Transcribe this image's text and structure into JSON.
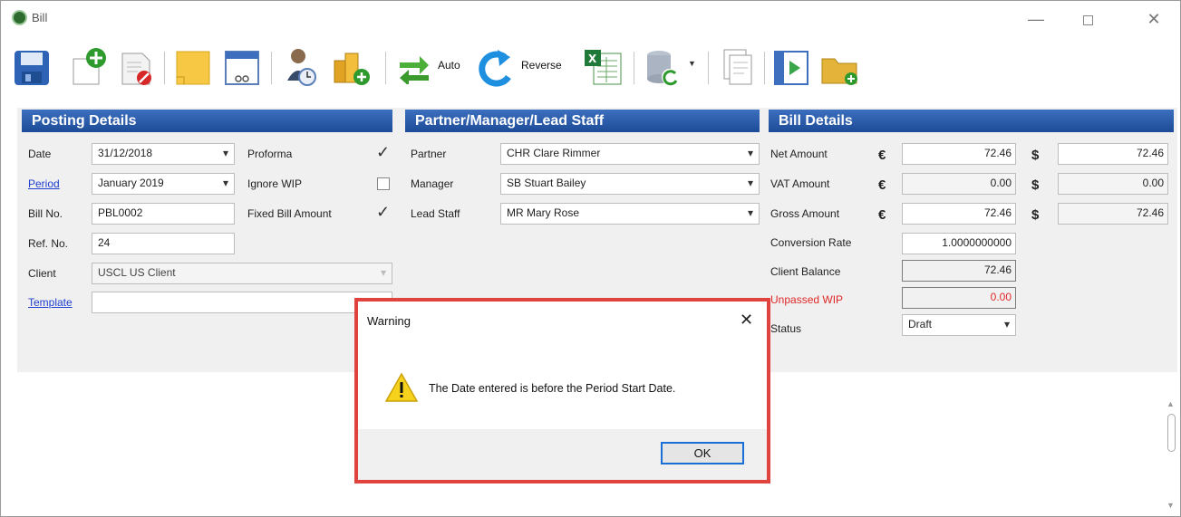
{
  "window": {
    "title": "Bill"
  },
  "toolbar": {
    "auto_label": "Auto",
    "reverse_label": "Reverse"
  },
  "posting": {
    "header": "Posting Details",
    "date_label": "Date",
    "date_value": "31/12/2018",
    "period_label": "Period",
    "period_value": "January 2019",
    "bill_no_label": "Bill No.",
    "bill_no_value": "PBL0002",
    "ref_no_label": "Ref. No.",
    "ref_no_value": "24",
    "client_label": "Client",
    "client_value": "USCL   US Client",
    "template_label": "Template",
    "template_value": "",
    "proforma_label": "Proforma",
    "proforma_checked": true,
    "ignore_wip_label": "Ignore WIP",
    "ignore_wip_checked": false,
    "fixed_bill_label": "Fixed Bill Amount",
    "fixed_bill_checked": true
  },
  "staff": {
    "header": "Partner/Manager/Lead Staff",
    "partner_label": "Partner",
    "partner_value": "CHR   Clare Rimmer",
    "manager_label": "Manager",
    "manager_value": "SB   Stuart Bailey",
    "lead_label": "Lead Staff",
    "lead_value": "MR   Mary Rose"
  },
  "bill": {
    "header": "Bill Details",
    "euro_symbol": "€",
    "dollar_symbol": "$",
    "net_label": "Net Amount",
    "net_eur": "72.46",
    "net_usd": "72.46",
    "vat_label": "VAT Amount",
    "vat_eur": "0.00",
    "vat_usd": "0.00",
    "gross_label": "Gross Amount",
    "gross_eur": "72.46",
    "gross_usd": "72.46",
    "conv_label": "Conversion Rate",
    "conv_value": "1.0000000000",
    "balance_label": "Client Balance",
    "balance_value": "72.46",
    "wip_label": "Unpassed WIP",
    "wip_value": "0.00",
    "status_label": "Status",
    "status_value": "Draft"
  },
  "dialog": {
    "title": "Warning",
    "message": "The Date entered is before the Period Start Date.",
    "ok_label": "OK",
    "border_color": "#e0433e"
  },
  "colors": {
    "section_header": "#1d4b97",
    "link": "#1f3fd0",
    "warning_text": "#e02828"
  }
}
